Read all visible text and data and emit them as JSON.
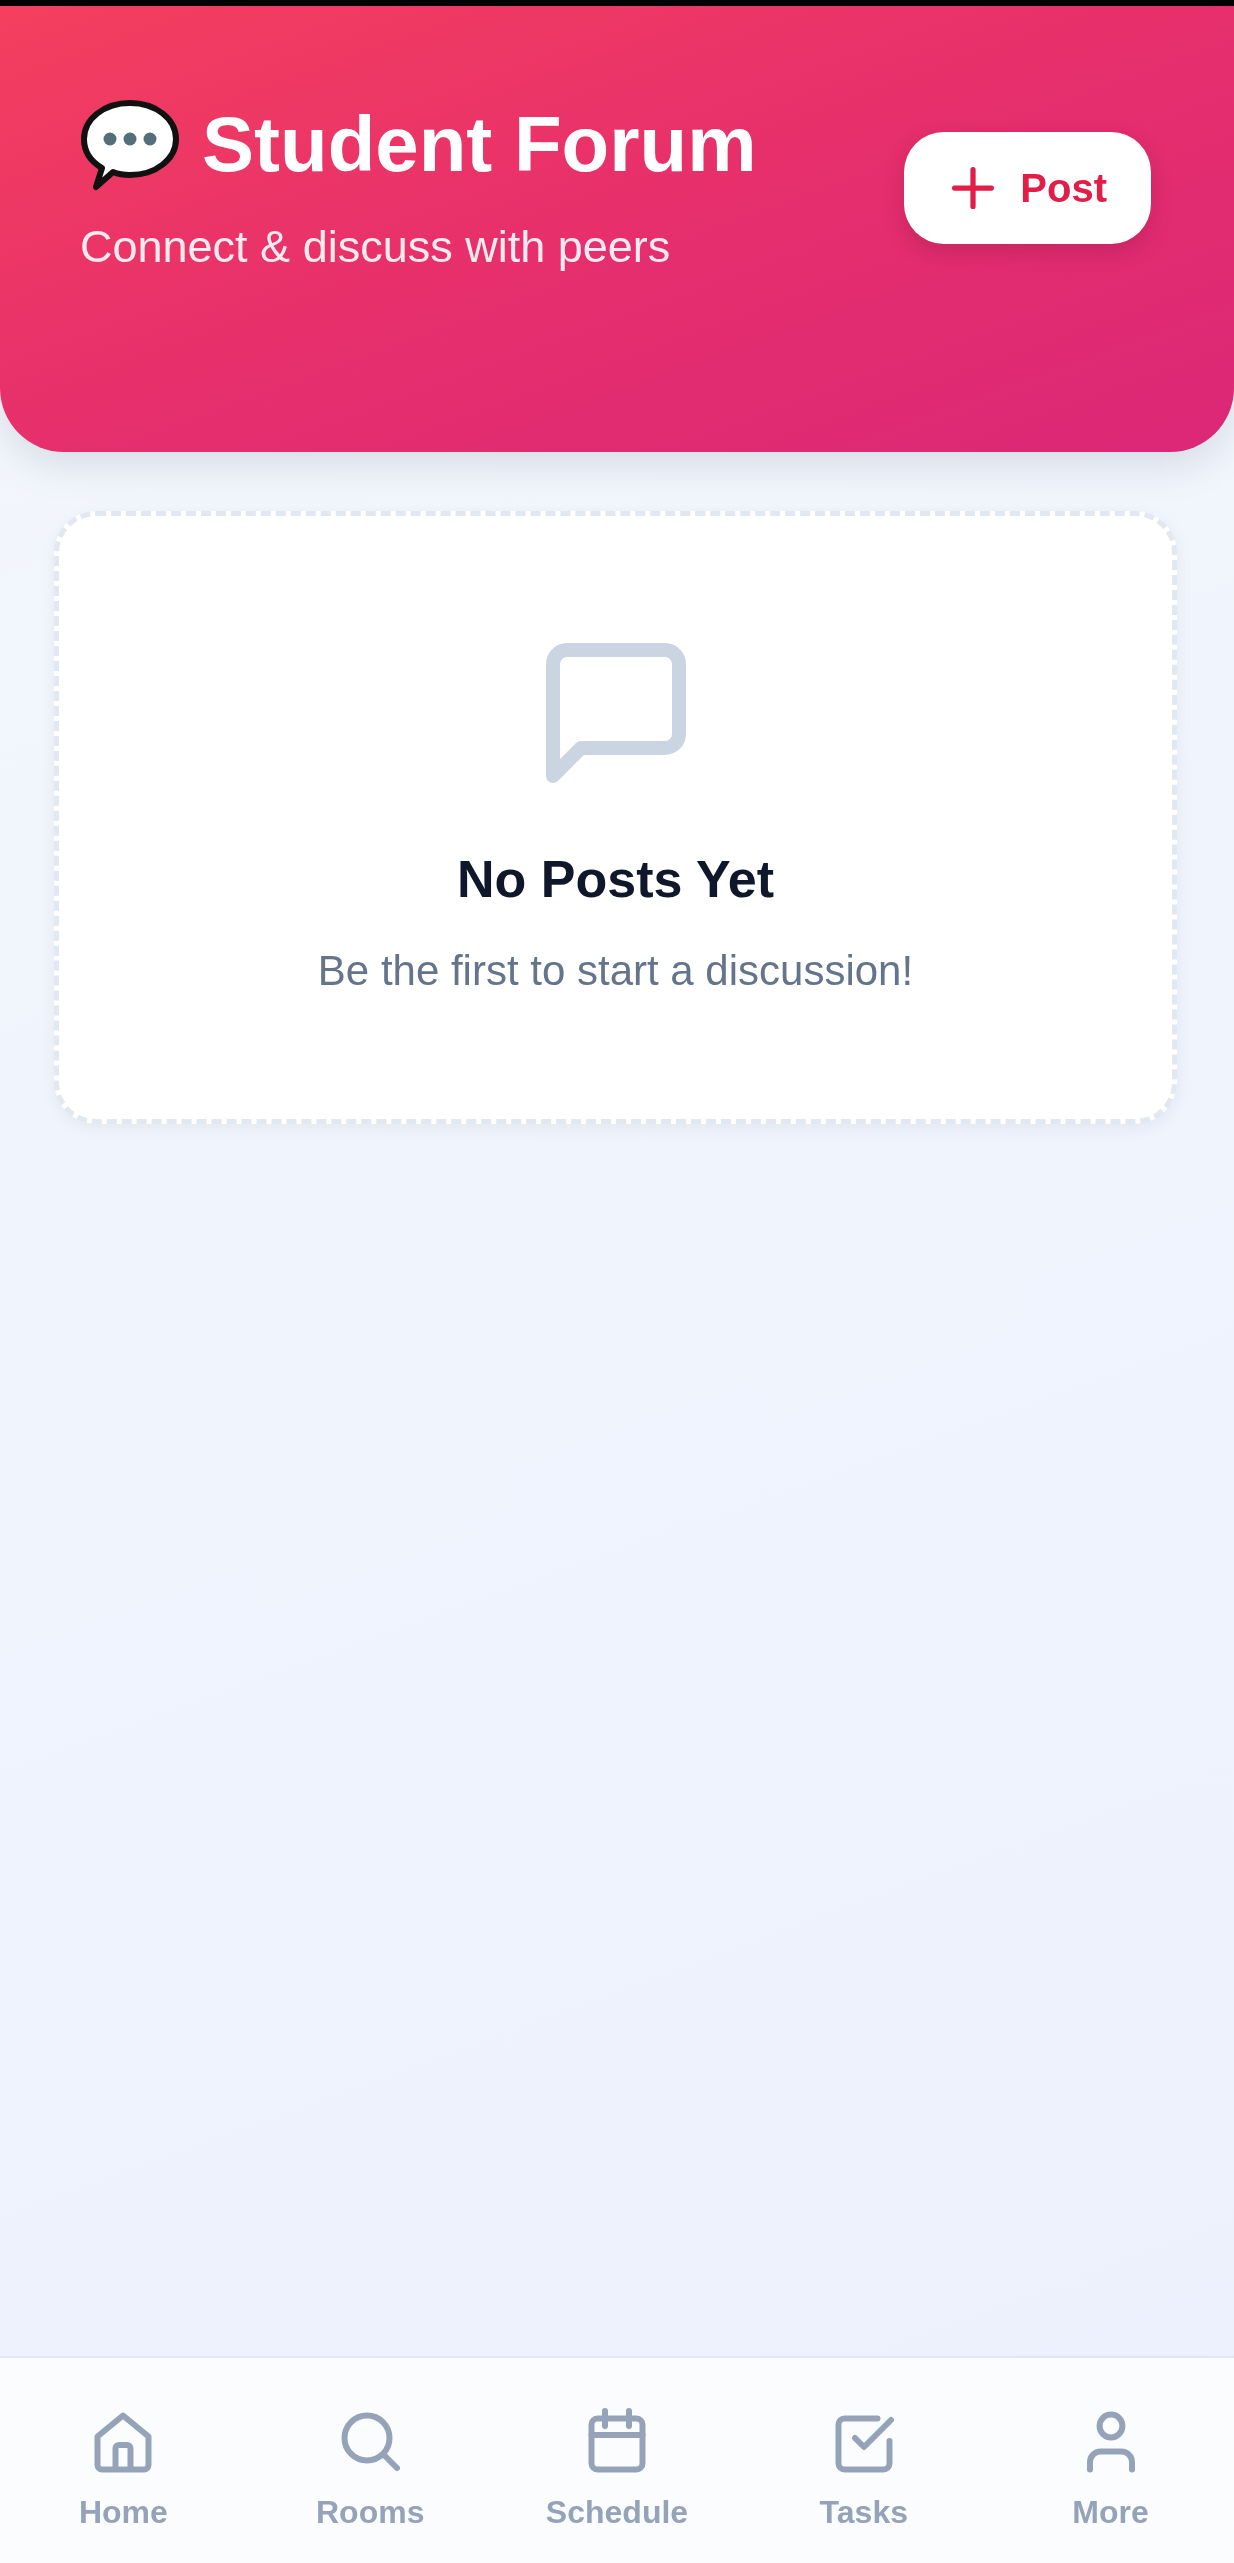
{
  "header": {
    "title": "Student Forum",
    "subtitle": "Connect & discuss with peers",
    "post_button": {
      "label": "Post"
    }
  },
  "empty_state": {
    "title": "No Posts Yet",
    "message": "Be the first to start a discussion!"
  },
  "bottom_nav": [
    {
      "label": "Home",
      "selected": false
    },
    {
      "label": "Rooms",
      "selected": false
    },
    {
      "label": "Schedule",
      "selected": false
    },
    {
      "label": "Tasks",
      "selected": false
    },
    {
      "label": "More",
      "selected": false
    }
  ]
}
